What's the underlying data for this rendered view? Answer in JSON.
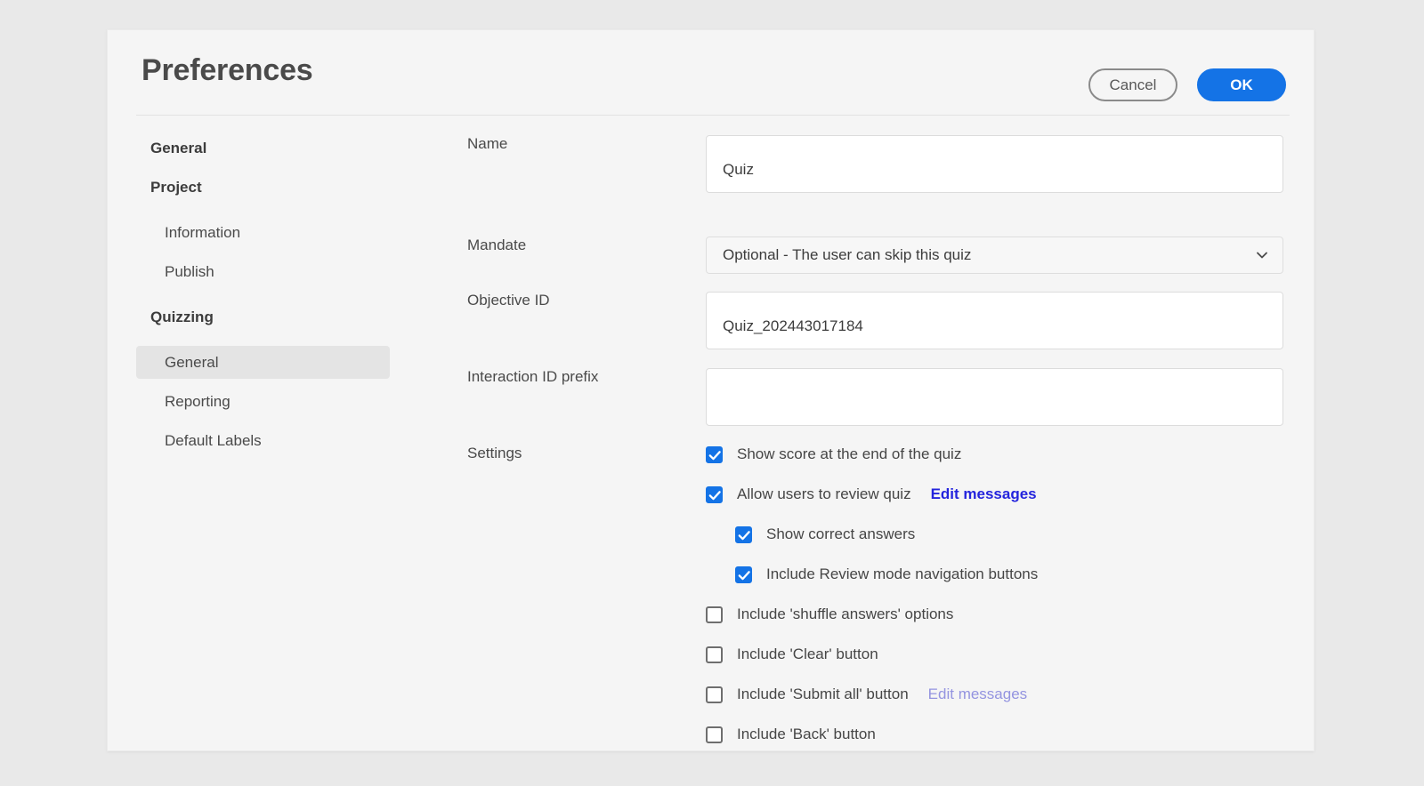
{
  "dialog": {
    "title": "Preferences",
    "cancel_label": "Cancel",
    "ok_label": "OK"
  },
  "sidebar": {
    "groups": [
      {
        "label": "General",
        "items": []
      },
      {
        "label": "Project",
        "items": [
          {
            "label": "Information",
            "selected": false
          },
          {
            "label": "Publish",
            "selected": false
          }
        ]
      },
      {
        "label": "Quizzing",
        "items": [
          {
            "label": "General",
            "selected": true
          },
          {
            "label": "Reporting",
            "selected": false
          },
          {
            "label": "Default Labels",
            "selected": false
          }
        ]
      }
    ]
  },
  "form": {
    "name": {
      "label": "Name",
      "value": "Quiz",
      "placeholder": ""
    },
    "mandate": {
      "label": "Mandate",
      "value": "Optional - The user can skip this quiz",
      "chevron_icon": "chevron-down-icon"
    },
    "objective_id": {
      "label": "Objective ID",
      "value": "Quiz_202443017184",
      "placeholder": ""
    },
    "interaction_id_prefix": {
      "label": "Interaction ID prefix",
      "value": "",
      "placeholder": ""
    },
    "settings": {
      "label": "Settings",
      "options": [
        {
          "label": "Show score at the end of the quiz",
          "checked": true,
          "indent": false,
          "link": null
        },
        {
          "label": "Allow users to review quiz",
          "checked": true,
          "indent": false,
          "link": {
            "label": "Edit messages",
            "enabled": true
          }
        },
        {
          "label": "Show correct answers",
          "checked": true,
          "indent": true,
          "link": null
        },
        {
          "label": "Include Review mode navigation buttons",
          "checked": true,
          "indent": true,
          "link": null
        },
        {
          "label": "Include 'shuffle answers' options",
          "checked": false,
          "indent": false,
          "link": null
        },
        {
          "label": "Include 'Clear' button",
          "checked": false,
          "indent": false,
          "link": null
        },
        {
          "label": "Include 'Submit all' button",
          "checked": false,
          "indent": false,
          "link": {
            "label": "Edit messages",
            "enabled": false
          }
        },
        {
          "label": "Include 'Back' button",
          "checked": false,
          "indent": false,
          "link": null
        }
      ]
    }
  },
  "colors": {
    "accent_blue": "#1473e6",
    "link_blue": "#2424dd",
    "link_disabled": "#9494e0",
    "dialog_bg": "#f5f5f5",
    "page_bg": "#e9e9e9",
    "selected_nav": "#e4e4e4"
  }
}
